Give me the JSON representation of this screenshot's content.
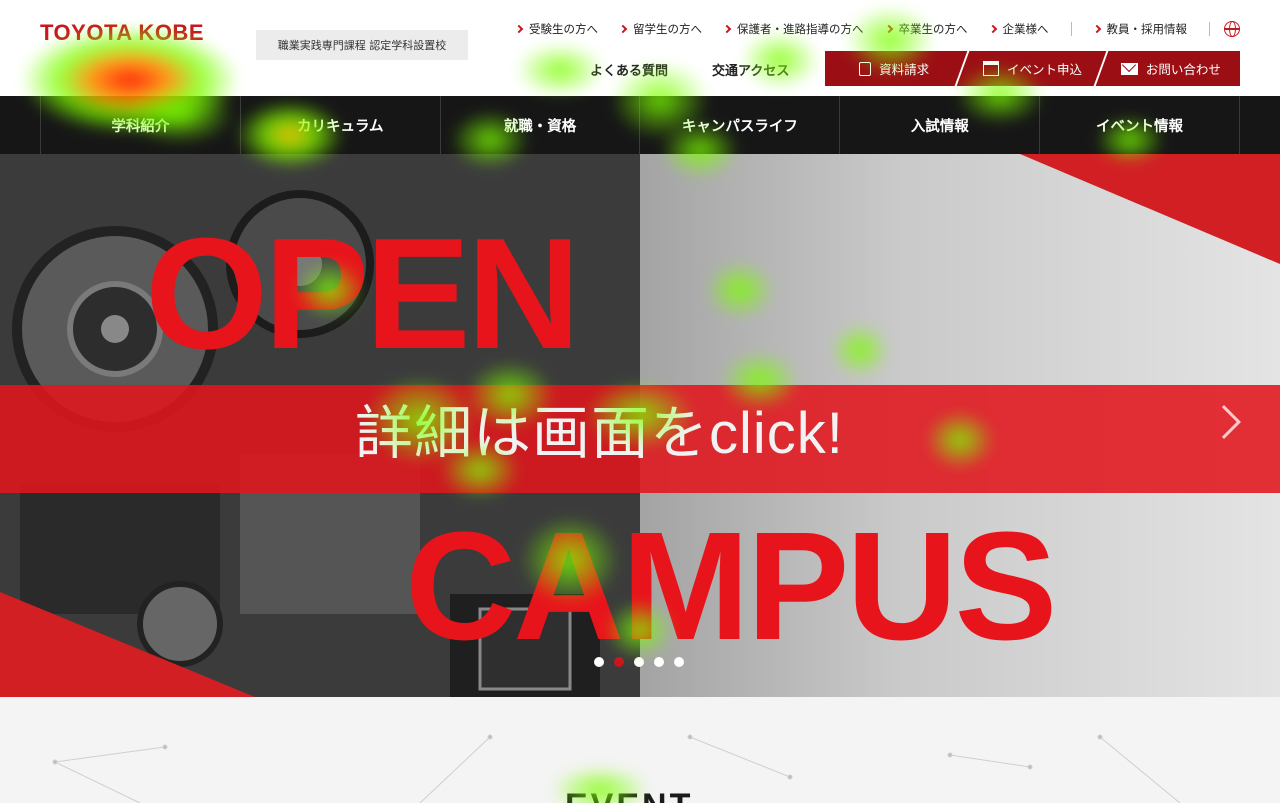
{
  "header": {
    "logo_text": "TOYOTA KOBE",
    "accreditation": "職業実践専門課程 認定学科設置校",
    "top_links": [
      "受験生の方へ",
      "留学生の方へ",
      "保護者・進路指導の方へ",
      "卒業生の方へ",
      "企業様へ",
      "教員・採用情報"
    ],
    "sub_links": [
      "よくある質問",
      "交通アクセス"
    ],
    "cta": [
      {
        "label": "資料請求",
        "icon": "document-icon"
      },
      {
        "label": "イベント申込",
        "icon": "calendar-icon"
      },
      {
        "label": "お問い合わせ",
        "icon": "mail-icon"
      }
    ],
    "globe_icon": "globe-icon"
  },
  "nav": {
    "items": [
      "学科紹介",
      "カリキュラム",
      "就職・資格",
      "キャンパスライフ",
      "入試情報",
      "イベント情報"
    ]
  },
  "hero": {
    "line1": "OPEN",
    "band": "詳細は画面をclick!",
    "line2": "CAMPUS",
    "slides": 5,
    "active_slide": 2
  },
  "event": {
    "title": "EVENT"
  },
  "colors": {
    "brand_red": "#c8161d",
    "cta_dark_red": "#9b0f14",
    "nav_bg": "#161616"
  }
}
